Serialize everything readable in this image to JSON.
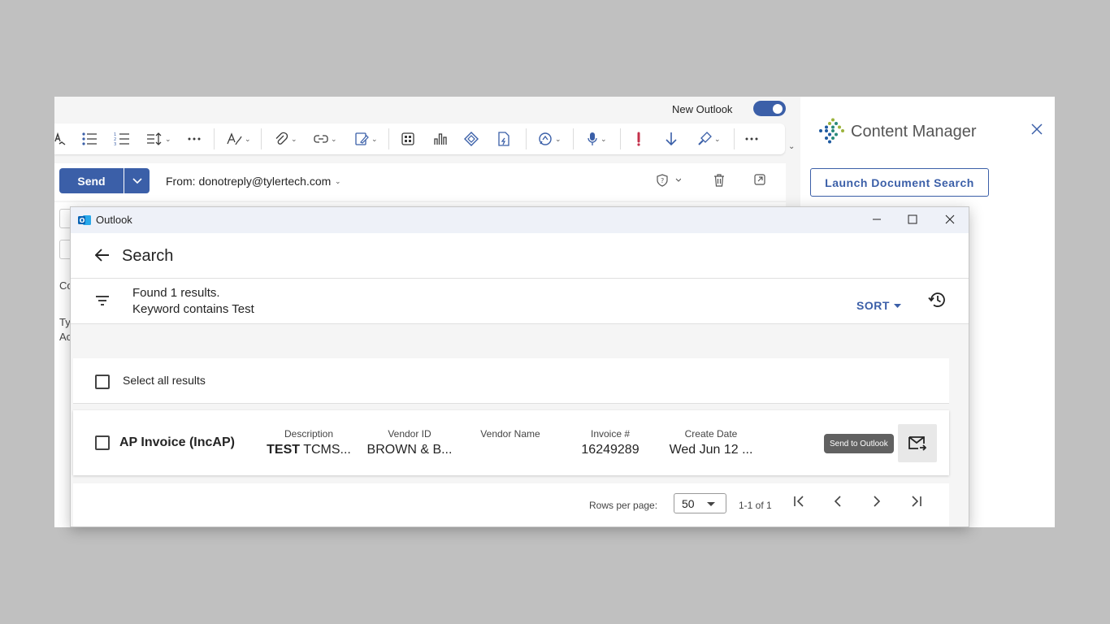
{
  "outlook": {
    "new_outlook_label": "New Outlook",
    "new_outlook_enabled": true,
    "send_label": "Send",
    "from_label": "From: donotreply@tylertech.com",
    "body_fragments": [
      "Co",
      "Ty",
      "Ac"
    ]
  },
  "content_manager": {
    "title": "Content Manager",
    "launch_button": "Launch Document Search"
  },
  "dialog": {
    "app_title": "Outlook",
    "search_title": "Search",
    "found_text": "Found 1 results.",
    "keyword_text": "Keyword contains Test",
    "sort_label": "SORT",
    "select_all_label": "Select all results",
    "result": {
      "doc_type": "AP Invoice (IncAP)",
      "columns": [
        {
          "header": "Description",
          "value_bold": "TEST",
          "value": " TCMS..."
        },
        {
          "header": "Vendor ID",
          "value": "BROWN & B..."
        },
        {
          "header": "Vendor Name",
          "value": ""
        },
        {
          "header": "Invoice #",
          "value": "16249289"
        },
        {
          "header": "Create Date",
          "value": "Wed Jun 12 ..."
        }
      ],
      "tooltip": "Send to Outlook"
    },
    "pagination": {
      "rows_label": "Rows per page:",
      "rows_value": "50",
      "range": "1-1 of 1"
    }
  },
  "colors": {
    "accent": "#3b5fa8",
    "background": "#c0c0c0"
  },
  "icons": {
    "ribbon": [
      "spell-check-icon",
      "bullet-list-icon",
      "numbered-list-icon",
      "line-spacing-icon",
      "more-icon",
      "styles-icon",
      "attach-icon",
      "link-icon",
      "signature-icon",
      "apps-icon",
      "chart-icon",
      "loop-icon",
      "forms-icon",
      "copilot-icon",
      "dictate-icon",
      "importance-high-icon",
      "importance-low-icon",
      "format-painter-icon",
      "more-icon"
    ]
  }
}
